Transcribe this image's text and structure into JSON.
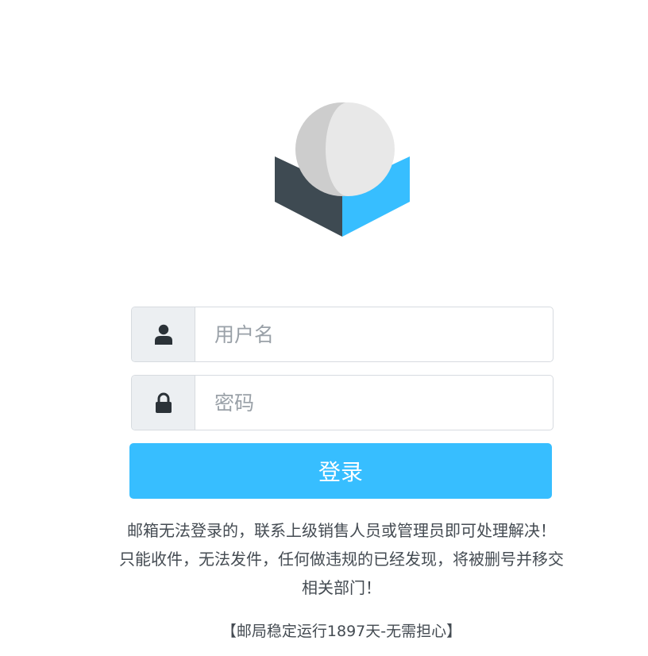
{
  "login": {
    "username": {
      "value": "",
      "placeholder": "用户名",
      "icon": "user-icon"
    },
    "password": {
      "value": "",
      "placeholder": "密码",
      "icon": "lock-icon"
    },
    "submit_label": "登录"
  },
  "notice": "邮箱无法登录的，联系上级销售人员或管理员即可处理解决！ 只能收件，无法发件，任何做违规的已经发现，将被删号并移交相关部门！",
  "uptime": "【邮局稳定运行1897天-无需担心】",
  "colors": {
    "accent": "#37beff",
    "logo_dark": "#3e4a52",
    "logo_blue": "#37beff",
    "logo_sphere": "#e3e3e3",
    "addon_bg": "#eceff2"
  }
}
